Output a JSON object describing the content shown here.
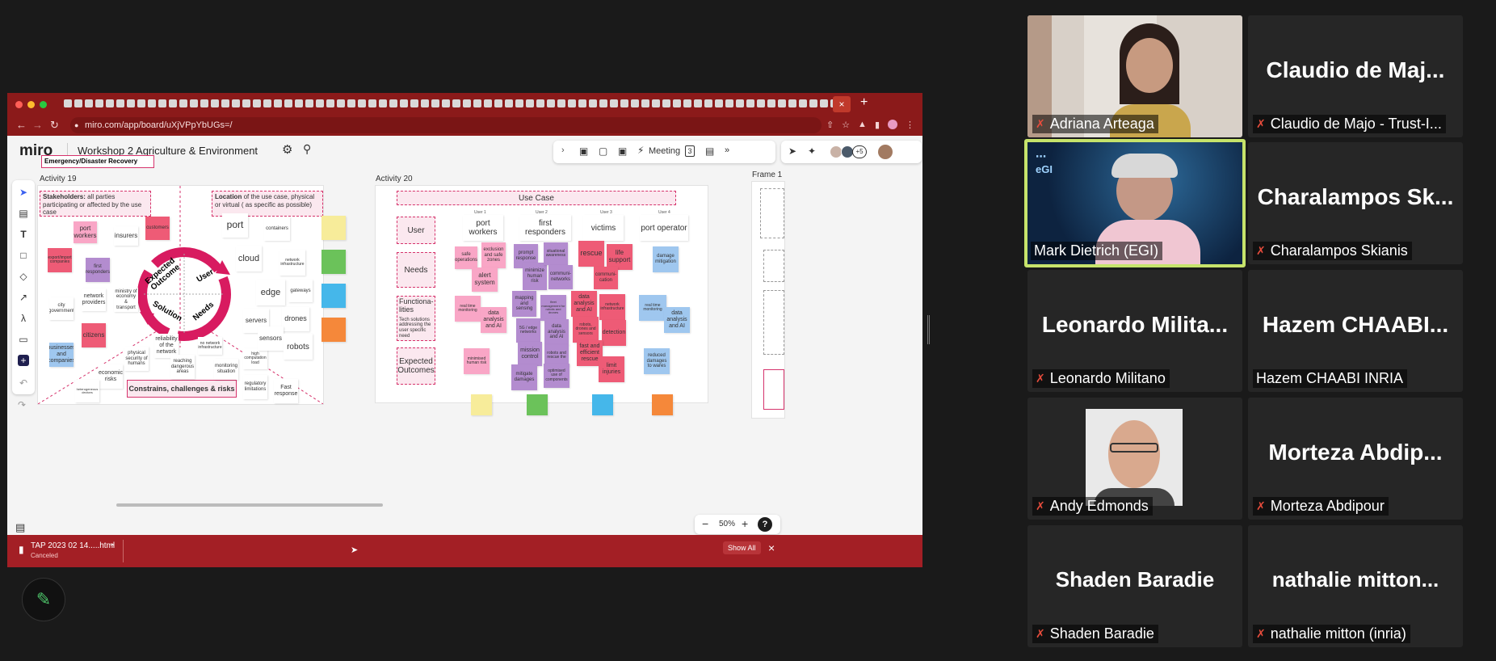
{
  "browser": {
    "url": "miro.com/app/board/uXjVPpYbUGs=/",
    "tab_close": "×",
    "tab_new": "+"
  },
  "miro": {
    "logo": "miro",
    "board_title": "Workshop 2 Agriculture & Environment",
    "meeting_label": "Meeting",
    "timer_count": "3",
    "plus_collaborators": "+5",
    "zoom": "50%",
    "help": "?",
    "activity19_label": "Activity 19",
    "activity20_label": "Activity 20",
    "frame1_label": "Frame 1",
    "emergency_label": "Emergency/Disaster Recovery",
    "stakeholders_title": "Stakeholders:",
    "stakeholders_text": " all parties participating or affected by the use case",
    "location_title": "Location",
    "location_text": " of the use case, physical or virtual ( as specific as possible)",
    "constraints_label": "Constrains, challenges & risks",
    "wheel": {
      "expected": "Expected Outcome",
      "user": "User",
      "solution": "Solution",
      "needs": "Needs"
    },
    "usecase_header": "Use Case",
    "row_labels": {
      "user": "User",
      "needs": "Needs",
      "func": "Functiona-lities",
      "func_sub": "Tech solutions addressing the user specific need",
      "outcomes": "Expected Outcomes"
    },
    "col_headers": [
      "port workers",
      "first responders",
      "victims",
      "port operator"
    ],
    "col_sub": [
      "User 1",
      "User 2",
      "User 3",
      "User 4"
    ],
    "stakeholder_notes": [
      "port workers",
      "insurers",
      "customers",
      "export/import companies",
      "first responders",
      "network providers",
      "ministry of economy & transport",
      "city government",
      "citizens",
      "businesses and companies",
      "physical security of humans",
      "economic risks",
      "heterogeneous devices",
      "reliability of the network",
      "reaching dangerous areas",
      "no network infrastructure",
      "monitoring situation",
      "high computation load",
      "regulatory limitations",
      "Fast response"
    ],
    "location_notes": [
      "port",
      "containers",
      "cloud",
      "network infrastructure",
      "edge",
      "gateways",
      "servers",
      "drones",
      "sensors",
      "robots"
    ],
    "needs_notes": [
      "safe operations",
      "exclusion and safe zones",
      "alert system",
      "prompt response",
      "minimize human risk",
      "situational awareness",
      "communi-networks",
      "rescue",
      "life support",
      "communi-cation",
      "damage mitigation"
    ],
    "func_notes": [
      "real time monitoring",
      "data analysis and AI",
      "mapping and sensing",
      "5G / edge networks",
      "fleet management for robots and drones",
      "data analysis and AI",
      "data analysis and AI",
      "network infrastructure",
      "robots, drones and sensors",
      "detection",
      "real time monitoring",
      "data analysis and AI"
    ],
    "outcome_notes": [
      "minimised human risk",
      "mission control",
      "mitigate damages",
      "robots and rescue the",
      "optimised use of components",
      "fast and efficient rescue",
      "limit injuries",
      "reduced damages to wares"
    ]
  },
  "download": {
    "filename": "TAP 2023 02 14.....html",
    "status": "Canceled",
    "show_all": "Show All",
    "close": "×"
  },
  "participants": [
    {
      "name": "Adriana Arteaga",
      "muted": true,
      "video": true
    },
    {
      "name": "Claudio de Majo - Trust-I...",
      "big": "Claudio de Maj...",
      "muted": true
    },
    {
      "name": "Mark Dietrich (EGI)",
      "muted": false,
      "video": true,
      "active": true
    },
    {
      "name": "Charalampos Skianis",
      "big": "Charalampos Sk...",
      "muted": true
    },
    {
      "name": "Leonardo Militano",
      "big": "Leonardo Milita...",
      "muted": true
    },
    {
      "name": "Hazem CHAABI INRIA",
      "big": "Hazem CHAABI...",
      "muted": false
    },
    {
      "name": "Andy Edmonds",
      "muted": true,
      "video": true
    },
    {
      "name": "Morteza Abdipour",
      "big": "Morteza Abdip...",
      "muted": true
    },
    {
      "name": "Shaden Baradie",
      "big": "Shaden Baradie",
      "muted": true
    },
    {
      "name": "nathalie mitton (inria)",
      "big": "nathalie mitton...",
      "muted": true
    }
  ],
  "colors": {
    "browser_red": "#8b1a1a",
    "active_speaker": "#c6e36b",
    "sticky_pink": "#f9a6c6",
    "sticky_red": "#ee5b76",
    "sticky_purple": "#b38ccf",
    "sticky_blue": "#9fc7ef"
  }
}
